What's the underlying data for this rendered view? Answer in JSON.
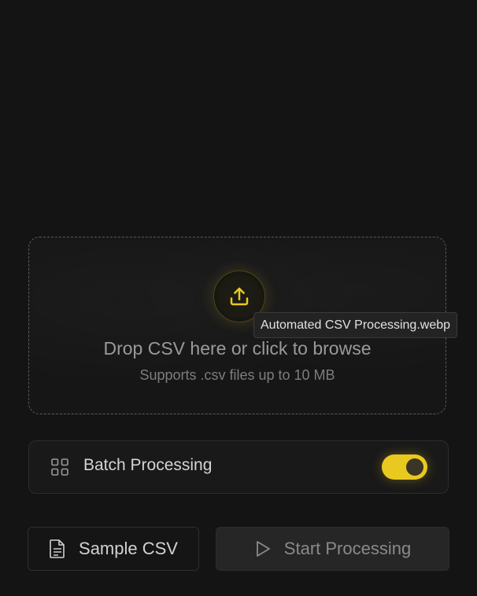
{
  "dropzone": {
    "title": "Drop CSV here or click to browse",
    "subtitle": "Supports .csv files up to 10 MB",
    "icon": "upload-icon",
    "tooltip": "Automated CSV Processing.webp"
  },
  "batch": {
    "label": "Batch Processing",
    "icon": "grid-icon",
    "enabled": true
  },
  "actions": {
    "sample_label": "Sample CSV",
    "sample_icon": "file-icon",
    "start_label": "Start Processing",
    "start_icon": "play-icon"
  },
  "colors": {
    "accent": "#e9c920",
    "background": "#141414"
  }
}
